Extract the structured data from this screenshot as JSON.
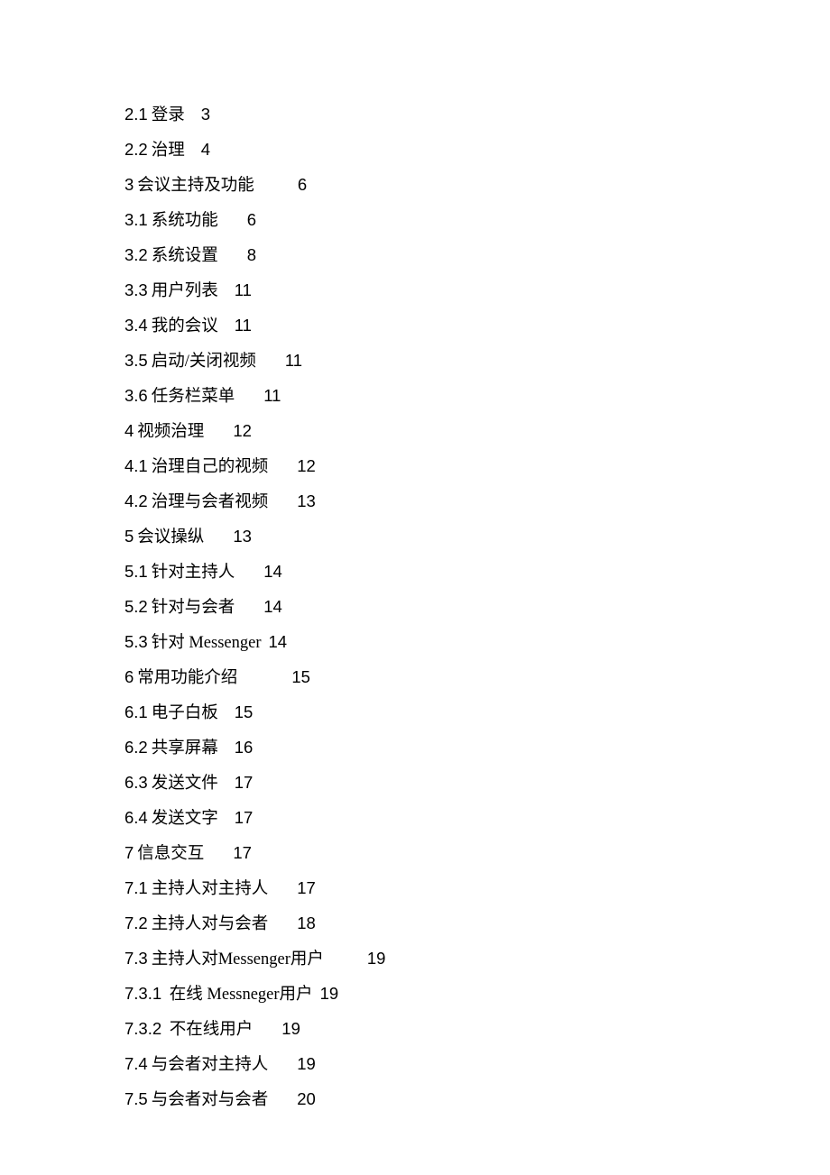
{
  "toc": [
    {
      "num": "2.1",
      "title": "登录",
      "page": "3",
      "gap": "gap-small"
    },
    {
      "num": "2.2",
      "title": "治理",
      "page": "4",
      "gap": "gap-small"
    },
    {
      "num": "3",
      "title": "会议主持及功能",
      "page": "6",
      "gap": "gap-large"
    },
    {
      "num": "3.1",
      "title": "系统功能",
      "page": "6",
      "gap": "gap-med"
    },
    {
      "num": "3.2",
      "title": "系统设置",
      "page": "8",
      "gap": "gap-med"
    },
    {
      "num": "3.3",
      "title": "用户列表",
      "page": "11",
      "gap": "gap-small"
    },
    {
      "num": "3.4",
      "title": "我的会议",
      "page": "11",
      "gap": "gap-small"
    },
    {
      "num": "3.5",
      "title": "启动/关闭视频",
      "page": "11",
      "gap": "gap-med"
    },
    {
      "num": "3.6",
      "title": "任务栏菜单",
      "page": "11",
      "gap": "gap-med"
    },
    {
      "num": "4",
      "title": "视频治理",
      "page": "12",
      "gap": "gap-med"
    },
    {
      "num": "4.1",
      "title": "治理自己的视频",
      "page": "12",
      "gap": "gap-med"
    },
    {
      "num": "4.2",
      "title": "治理与会者视频",
      "page": "13",
      "gap": "gap-med"
    },
    {
      "num": "5",
      "title": "会议操纵",
      "page": "13",
      "gap": "gap-med"
    },
    {
      "num": "5.1",
      "title": "针对主持人",
      "page": "14",
      "gap": "gap-med"
    },
    {
      "num": "5.2",
      "title": "针对与会者",
      "page": "14",
      "gap": "gap-med"
    },
    {
      "num": "5.3",
      "title": "针对 Messenger",
      "page": "14",
      "gap": "gap-tiny"
    },
    {
      "num": "6",
      "title": "常用功能介绍",
      "page": "15",
      "gap": "gap-xlarge"
    },
    {
      "num": "6.1",
      "title": "电子白板",
      "page": "15",
      "gap": "gap-small"
    },
    {
      "num": "6.2",
      "title": "共享屏幕",
      "page": "16",
      "gap": "gap-small"
    },
    {
      "num": "6.3",
      "title": "发送文件",
      "page": "17",
      "gap": "gap-small"
    },
    {
      "num": "6.4",
      "title": "发送文字",
      "page": "17",
      "gap": "gap-small"
    },
    {
      "num": "7",
      "title": "信息交互",
      "page": "17",
      "gap": "gap-med"
    },
    {
      "num": "7.1",
      "title": "主持人对主持人",
      "page": "17",
      "gap": "gap-med"
    },
    {
      "num": "7.2",
      "title": "主持人对与会者",
      "page": "18",
      "gap": "gap-med"
    },
    {
      "num": "7.3",
      "title": "主持人对Messenger用户",
      "page": "19",
      "gap": "gap-large"
    },
    {
      "num": "7.3.1",
      "title": "  在线 Messneger用户",
      "page": "19",
      "gap": "gap-tiny"
    },
    {
      "num": "7.3.2",
      "title": "  不在线用户",
      "page": "19",
      "gap": "gap-med"
    },
    {
      "num": "7.4",
      "title": "与会者对主持人",
      "page": "19",
      "gap": "gap-med"
    },
    {
      "num": "7.5",
      "title": "与会者对与会者",
      "page": "20",
      "gap": "gap-med"
    }
  ]
}
